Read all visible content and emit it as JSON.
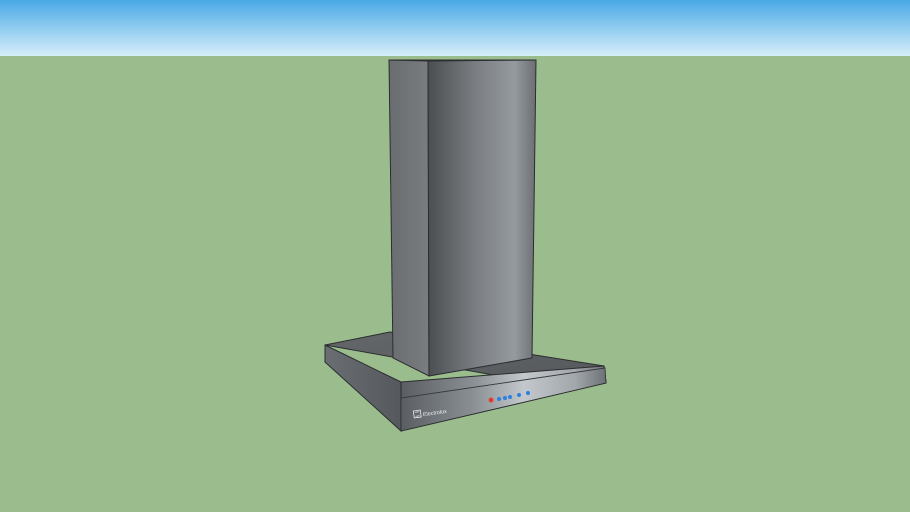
{
  "scene": {
    "colors": {
      "sky_top": "#4aa9e6",
      "sky_bottom": "#d4ecf8",
      "ground": "#9bbd8e",
      "chimney_side": "#6f7275",
      "chimney_front_dark": "#4b4e51",
      "chimney_front_light": "#8d9195",
      "canopy_top": "#5d6063",
      "canopy_front_light": "#b8bdc1",
      "canopy_front_dark": "#5a5e62",
      "outline": "#2b2d2f",
      "indicator_red": "#e03a2e",
      "indicator_blue": "#2f7fe0"
    }
  },
  "appliance": {
    "type": "chimney range hood",
    "brand": "Electrolux",
    "indicators": [
      "red",
      "blue",
      "blue",
      "blue",
      "blue",
      "blue"
    ]
  }
}
